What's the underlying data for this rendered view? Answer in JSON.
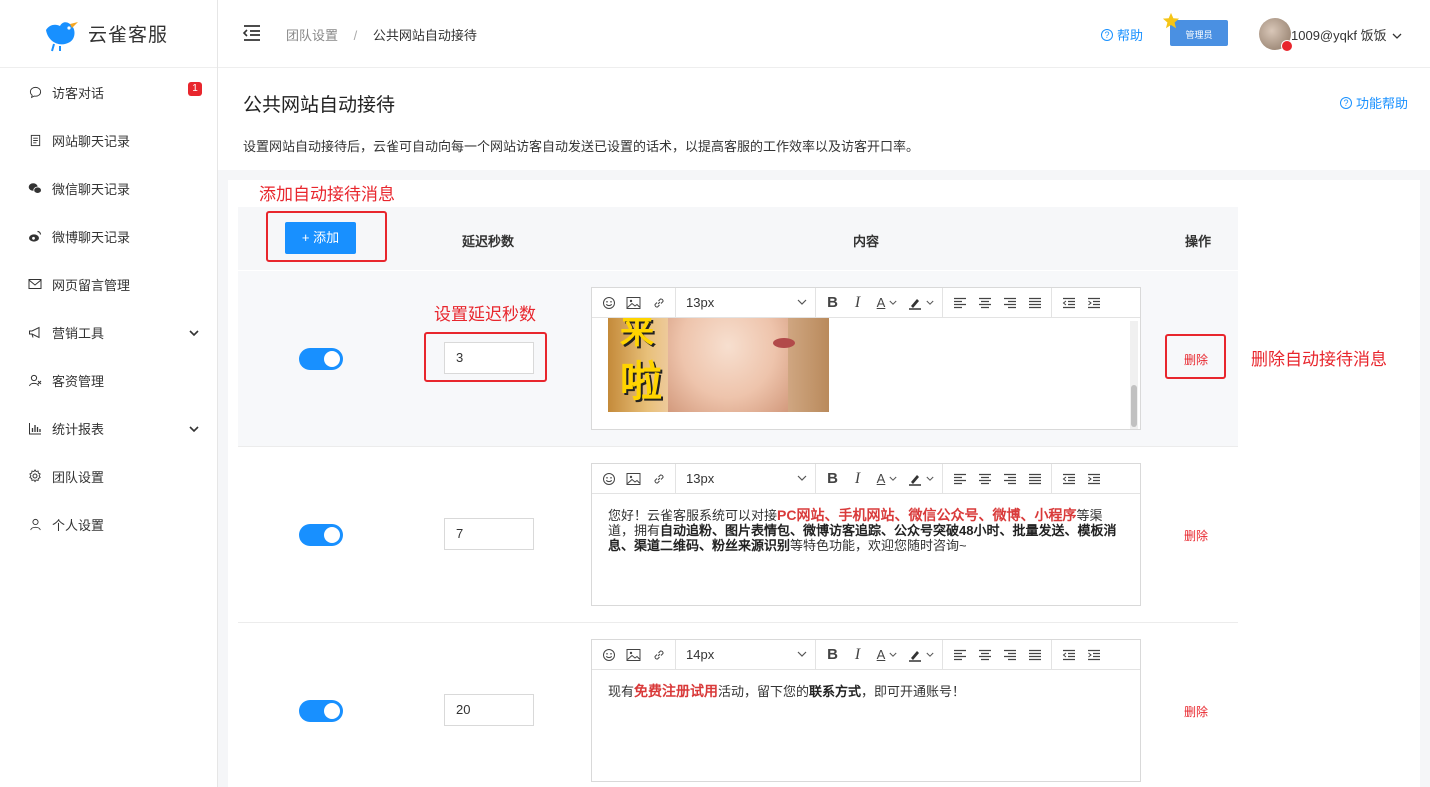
{
  "brand": {
    "name": "云雀客服",
    "color": "#1890ff"
  },
  "sidebar": {
    "items": [
      {
        "label": "访客对话",
        "icon": "chat-bubble-icon",
        "badge": "1"
      },
      {
        "label": "网站聊天记录",
        "icon": "document-icon"
      },
      {
        "label": "微信聊天记录",
        "icon": "wechat-icon"
      },
      {
        "label": "微博聊天记录",
        "icon": "weibo-icon"
      },
      {
        "label": "网页留言管理",
        "icon": "mail-icon"
      },
      {
        "label": "营销工具",
        "icon": "megaphone-icon",
        "expandable": true
      },
      {
        "label": "客资管理",
        "icon": "contacts-icon"
      },
      {
        "label": "统计报表",
        "icon": "bar-chart-icon",
        "expandable": true
      },
      {
        "label": "团队设置",
        "icon": "gear-icon"
      },
      {
        "label": "个人设置",
        "icon": "user-icon"
      }
    ]
  },
  "header": {
    "breadcrumb": [
      "团队设置",
      "公共网站自动接待"
    ],
    "separator": "/",
    "help": "帮助",
    "role": "管理员",
    "user": "1009@yqkf 饭饭"
  },
  "page": {
    "title": "公共网站自动接待",
    "func_help": "功能帮助",
    "description": "设置网站自动接待后，云雀可自动向每一个网站访客自动发送已设置的话术，以提高客服的工作效率以及访客开口率。"
  },
  "annotations": {
    "add": "添加自动接待消息",
    "delay": "设置延迟秒数",
    "delete": "删除自动接待消息",
    "color": "#e8262d"
  },
  "table": {
    "add_button": "+ 添加",
    "columns": [
      "延迟秒数",
      "内容",
      "操作"
    ],
    "rows": [
      {
        "enabled": true,
        "delay": "3",
        "font_size": "13px",
        "content_type": "image",
        "gif_text": [
          "来",
          "啦"
        ],
        "delete": "删除"
      },
      {
        "enabled": true,
        "delay": "7",
        "font_size": "13px",
        "content_type": "text",
        "text_parts": [
          {
            "t": "您好！云雀客服系统可以对接",
            "s": "normal"
          },
          {
            "t": "PC网站、手机网站、微信公众号、微博、小程序",
            "s": "red"
          },
          {
            "t": "等渠道，拥有",
            "s": "normal"
          },
          {
            "t": "自动追粉、图片表情包、微博访客追踪、公众号突破48小时、批量发送、模板消息、渠道二维码、粉丝来源识别",
            "s": "bold"
          },
          {
            "t": "等特色功能，欢迎您随时咨询~",
            "s": "normal"
          }
        ],
        "delete": "删除"
      },
      {
        "enabled": true,
        "delay": "20",
        "font_size": "14px",
        "content_type": "text",
        "text_parts": [
          {
            "t": "现有",
            "s": "normal"
          },
          {
            "t": "免费注册试用",
            "s": "red"
          },
          {
            "t": "活动，留下您的",
            "s": "normal"
          },
          {
            "t": "联系方式",
            "s": "bold"
          },
          {
            "t": "，即可开通账号！",
            "s": "normal"
          }
        ],
        "delete": "删除"
      }
    ]
  }
}
